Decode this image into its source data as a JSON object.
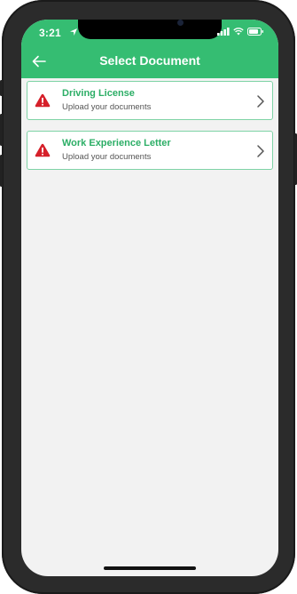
{
  "status_bar": {
    "time": "3:21"
  },
  "header": {
    "title": "Select Document"
  },
  "documents": [
    {
      "title": "Driving License",
      "subtitle": "Upload your documents"
    },
    {
      "title": "Work Experience Letter",
      "subtitle": "Upload your documents"
    }
  ],
  "icons": {
    "back": "arrow-left-icon",
    "warning": "warning-triangle-icon",
    "chevron": "chevron-right-icon",
    "location": "location-arrow-icon",
    "wifi": "wifi-icon",
    "battery": "battery-icon"
  },
  "colors": {
    "header_bg": "#35bd72",
    "accent_text": "#2cae66",
    "card_border": "#7fd3a6",
    "warning": "#d6202a",
    "background": "#f2f2f2"
  }
}
